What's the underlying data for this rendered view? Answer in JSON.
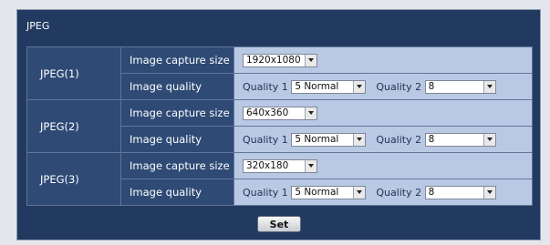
{
  "section": {
    "title": "JPEG"
  },
  "groups": [
    {
      "label": "JPEG(1)",
      "capture_label": "Image capture size",
      "capture_value": "1920x1080",
      "quality_label": "Image quality",
      "quality1_label": "Quality 1",
      "quality1_value": "5 Normal",
      "quality2_label": "Quality 2",
      "quality2_value": "8"
    },
    {
      "label": "JPEG(2)",
      "capture_label": "Image capture size",
      "capture_value": "640x360",
      "quality_label": "Image quality",
      "quality1_label": "Quality 1",
      "quality1_value": "5 Normal",
      "quality2_label": "Quality 2",
      "quality2_value": "8"
    },
    {
      "label": "JPEG(3)",
      "capture_label": "Image capture size",
      "capture_value": "320x180",
      "quality_label": "Image quality",
      "quality1_label": "Quality 1",
      "quality1_value": "5 Normal",
      "quality2_label": "Quality 2",
      "quality2_value": "8"
    }
  ],
  "actions": {
    "set_label": "Set"
  },
  "icons": {
    "dropdown": "chevron-down-icon"
  },
  "colors": {
    "panel_bg": "#223a60",
    "label_cell": "#2e4a75",
    "value_cell": "#b9c9e4"
  }
}
